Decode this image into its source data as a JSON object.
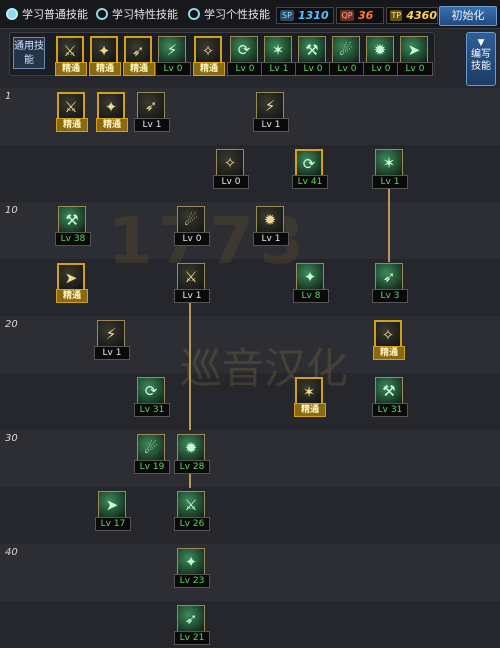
{
  "topbar": {
    "options": [
      {
        "label": "学习普通技能",
        "checked": true
      },
      {
        "label": "学习特性技能",
        "checked": false
      },
      {
        "label": "学习个性技能",
        "checked": false
      }
    ],
    "stats": [
      {
        "icon_text": "SP",
        "value": "1310",
        "color": "#4fc3ff"
      },
      {
        "icon_text": "QP",
        "value": "36",
        "color": "#ff7a3a"
      },
      {
        "icon_text": "TP",
        "value": "4360",
        "color": "#ffd34a"
      }
    ],
    "reset_label": "初始化"
  },
  "common": {
    "label": "通用技能",
    "skills": [
      {
        "badge": "精通"
      },
      {
        "badge": "精通"
      },
      {
        "badge": "精通"
      },
      {
        "badge": "Lv 0"
      },
      {
        "badge": "精通"
      },
      {
        "badge": "Lv 0"
      },
      {
        "badge": "Lv 1"
      },
      {
        "badge": "Lv 0"
      },
      {
        "badge": "Lv 0"
      },
      {
        "badge": "Lv 0"
      },
      {
        "badge": "Lv 0"
      }
    ]
  },
  "side_button": {
    "label": "编写技能"
  },
  "level_labels": [
    "1",
    "10",
    "20",
    "30",
    "40"
  ],
  "tree": [
    {
      "badge": "精通"
    },
    {
      "badge": "精通"
    },
    {
      "badge": "Lv 1"
    },
    {
      "badge": "Lv 1"
    },
    {
      "badge": "Lv 0"
    },
    {
      "badge": "Lv 41"
    },
    {
      "badge": "Lv 1"
    },
    {
      "badge": "Lv 38"
    },
    {
      "badge": "Lv 0"
    },
    {
      "badge": "Lv 1"
    },
    {
      "badge": "精通"
    },
    {
      "badge": "Lv 1"
    },
    {
      "badge": "Lv 8"
    },
    {
      "badge": "Lv 3"
    },
    {
      "badge": "Lv 1"
    },
    {
      "badge": "精通"
    },
    {
      "badge": "Lv 31"
    },
    {
      "badge": "精通"
    },
    {
      "badge": "Lv 31"
    },
    {
      "badge": "Lv 19"
    },
    {
      "badge": "Lv 28"
    },
    {
      "badge": "Lv 17"
    },
    {
      "badge": "Lv 26"
    },
    {
      "badge": "Lv 23"
    },
    {
      "badge": "Lv 21"
    }
  ],
  "watermark": {
    "text": "巡音汉化"
  },
  "icons": [
    "check-icon",
    "sp-icon",
    "qp-icon",
    "tp-icon",
    "arrow-down-icon",
    "skill-icon"
  ]
}
